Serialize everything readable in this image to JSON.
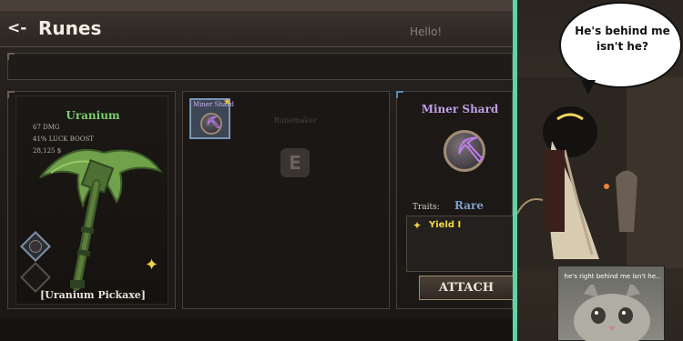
{
  "header": {
    "back_label": "<-",
    "title": "Runes",
    "chat_bubble": "Hello!"
  },
  "item": {
    "name": "Uranium",
    "stats": [
      "67 DMG",
      "41% LUCK BOOST",
      "28,125 $"
    ],
    "caption": "[Uranium Pickaxe]",
    "colors": {
      "name": "#7bd06a",
      "blade": "#6fa24a"
    }
  },
  "rune_grid": {
    "slots": [
      {
        "label": "Miner Shard",
        "icon": "pickaxe-rune-icon",
        "favorite": true
      }
    ],
    "background_label": "Runemaker",
    "ghost_key": "E"
  },
  "detail": {
    "title": "Miner Shard",
    "rarity": "Rare",
    "traits_label": "Traits:",
    "traits": [
      {
        "name": "Yield I",
        "icon": "sparkle-icon"
      }
    ],
    "attach_label": "ATTACH",
    "colors": {
      "title": "#c09ee6",
      "rarity": "#7f9fcc",
      "trait": "#f0d84a"
    }
  },
  "meme": {
    "speech": "He's behind me isn't he?",
    "cat_caption": "he's right behind me isn't he.."
  },
  "colors": {
    "frame": "#5fd3a6"
  }
}
